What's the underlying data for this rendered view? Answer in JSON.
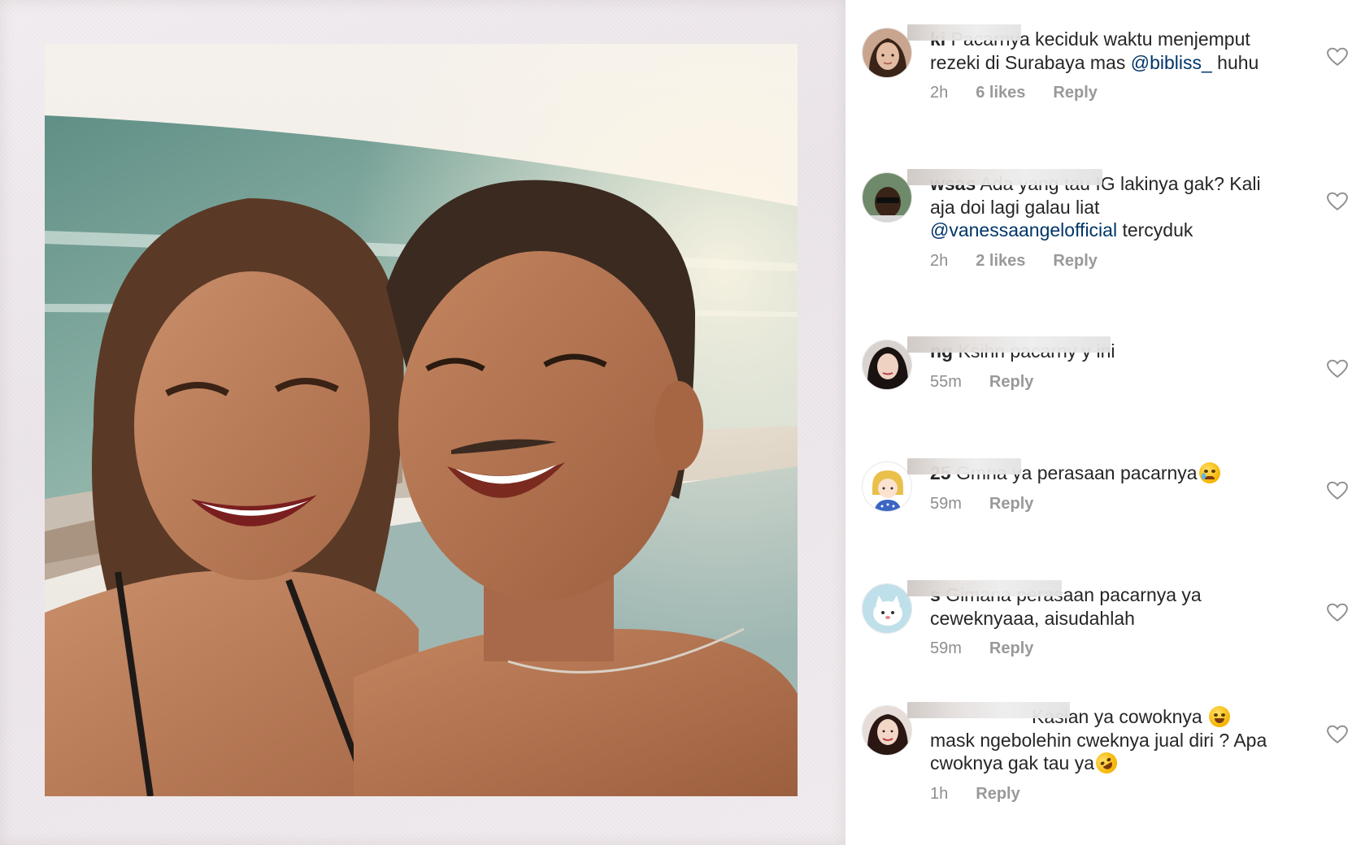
{
  "comments": [
    {
      "username": "ki",
      "text": " Pacarnya keciduk waktu menjemput rezeki di Surabaya mas ",
      "mention": "@bibliss_",
      "text_after": "  huhu",
      "time": "2h",
      "likes": "6 likes",
      "reply": "Reply",
      "avatar_icon": "profile-photo-woman"
    },
    {
      "username": "wsas",
      "text": " Ada yang tau IG lakinya gak? Kali aja doi lagi galau liat ",
      "mention": "@vanessaangelofficial",
      "text_after": " tercyduk",
      "time": "2h",
      "likes": "2 likes",
      "reply": "Reply",
      "avatar_icon": "profile-photo-man-sunglasses"
    },
    {
      "username": "ng",
      "text": " Ksihn pacarny y ini",
      "mention": "",
      "text_after": "",
      "time": "55m",
      "likes": "",
      "reply": "Reply",
      "avatar_icon": "profile-photo-woman-dark"
    },
    {
      "username": "25",
      "text": " Gmna ya perasaan pacarnya",
      "mention": "",
      "text_after": "",
      "emoji": "crying-face-emoji",
      "time": "59m",
      "likes": "",
      "reply": "Reply",
      "avatar_icon": "cartoon-girl-avatar"
    },
    {
      "username": "s",
      "text": " Gimana perasaan pacarnya ya ceweknyaaa, aisudahlah",
      "mention": "",
      "text_after": "",
      "time": "59m",
      "likes": "",
      "reply": "Reply",
      "avatar_icon": "cartoon-cat-avatar"
    },
    {
      "username": "",
      "text": " Kasian ya cowoknya ",
      "mention": "",
      "text_after": "",
      "emoji": "laughing-tears-emoji",
      "line2": "mask ngebolehin cweknya jual diri ? Apa cwoknya gak tau ya",
      "emoji2": "rolling-laughing-emoji",
      "time": "1h",
      "likes": "",
      "reply": "Reply",
      "avatar_icon": "profile-photo-woman-long-hair"
    }
  ],
  "colors": {
    "mention": "#003569",
    "meta": "#8e8e8e",
    "text": "#262626"
  }
}
